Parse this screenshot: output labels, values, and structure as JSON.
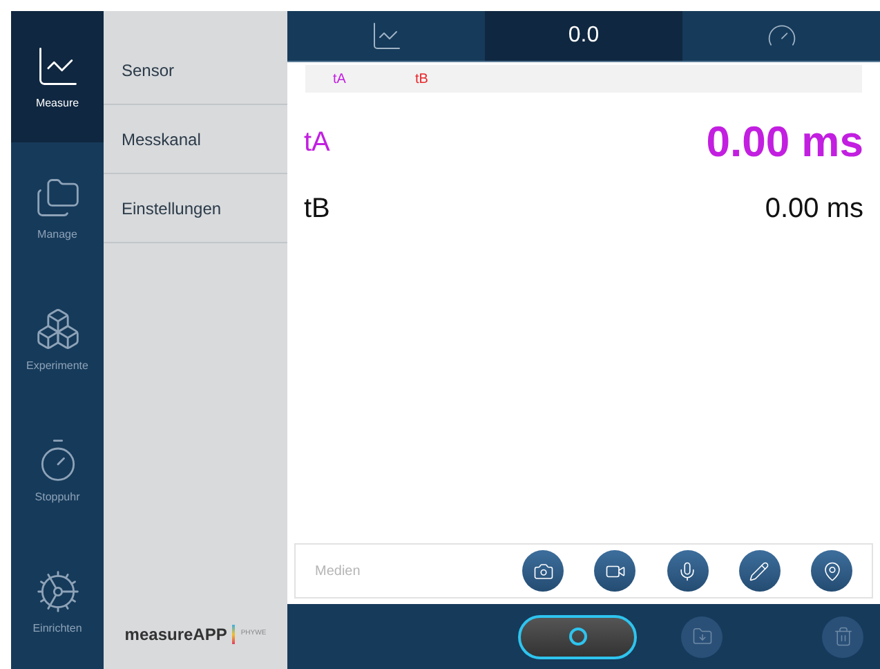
{
  "nav": [
    {
      "kind": "measure",
      "label": "Measure",
      "selected": true
    },
    {
      "kind": "manage",
      "label": "Manage",
      "selected": false
    },
    {
      "kind": "experiments",
      "label": "Experimente",
      "selected": false
    },
    {
      "kind": "stopwatch",
      "label": "Stoppuhr",
      "selected": false
    },
    {
      "kind": "settings",
      "label": "Einrichten",
      "selected": false
    }
  ],
  "submenu": [
    "Sensor",
    "Messkanal",
    "Einstellungen"
  ],
  "logo": {
    "name": "measureAPP",
    "brand": "PHYWE"
  },
  "tabs": [
    {
      "kind": "chart",
      "selected": false
    },
    {
      "kind": "value",
      "label": "0.0",
      "selected": true
    },
    {
      "kind": "gauge",
      "selected": false
    }
  ],
  "legend": [
    {
      "label": "tA",
      "color": "#c21fe0"
    },
    {
      "label": "tB",
      "color": "#e8262b"
    }
  ],
  "readings": [
    {
      "name": "tA",
      "value": "0.00 ms",
      "selected": true,
      "color": "#c21fe0"
    },
    {
      "name": "tB",
      "value": "0.00 ms",
      "selected": false,
      "color": "#111111"
    }
  ],
  "media": {
    "placeholder": "Medien",
    "buttons": [
      {
        "kind": "camera"
      },
      {
        "kind": "video"
      },
      {
        "kind": "microphone"
      },
      {
        "kind": "pencil"
      },
      {
        "kind": "location"
      }
    ]
  },
  "actions": [
    {
      "kind": "record",
      "disabled": false
    },
    {
      "kind": "import",
      "disabled": true
    },
    {
      "kind": "delete",
      "disabled": true
    }
  ]
}
